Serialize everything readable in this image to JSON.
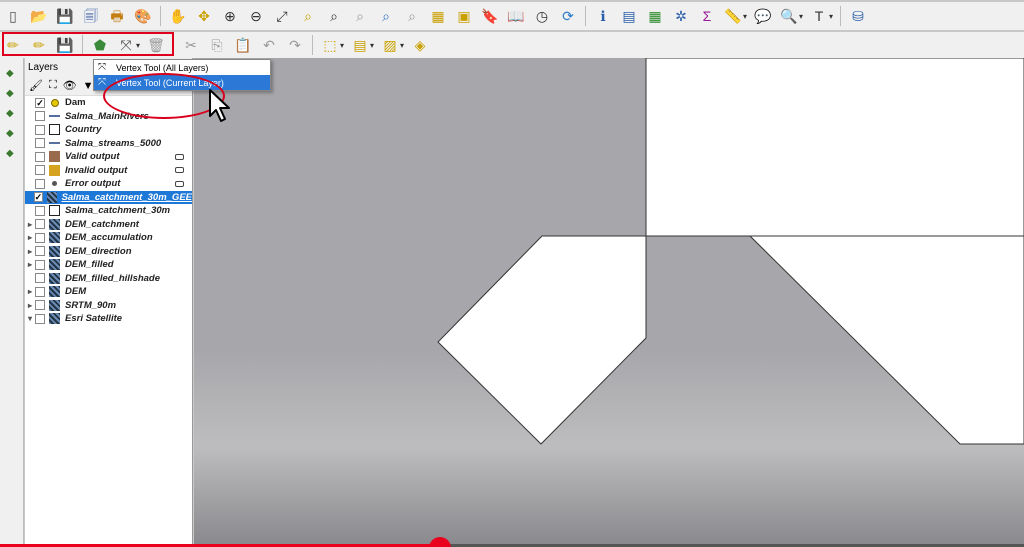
{
  "toolbar1": {
    "icons": [
      "new-project-icon",
      "open-folder-icon",
      "save-icon",
      "save-as-icon",
      "print-layout-icon",
      "style-manager-icon",
      "pan-hand-icon",
      "pan-to-selection-icon",
      "zoom-in-icon",
      "zoom-out-icon",
      "zoom-full-icon",
      "zoom-to-selection-icon",
      "zoom-to-layer-icon",
      "zoom-native-icon",
      "zoom-last-icon",
      "zoom-next-icon",
      "new-map-view-icon",
      "new-3d-view-icon",
      "new-bookmark-icon",
      "show-bookmarks-icon",
      "temporal-icon",
      "refresh-icon",
      "identify-icon",
      "attribute-table-icon",
      "field-calculator-icon",
      "processing-toolbox-icon",
      "statistics-icon",
      "measure-icon",
      "annotation-icon",
      "label-tool-icon",
      "text-annotation-icon",
      "database-icon"
    ]
  },
  "toolbar2": {
    "icons": [
      "toggle-editing-pencil-icon",
      "current-edits-pencil-icon",
      "save-edits-icon",
      "add-polygon-icon",
      "vertex-tool-icon",
      "delete-selected-icon",
      "cut-icon",
      "copy-icon",
      "paste-icon",
      "undo-icon",
      "redo-icon",
      "select-features-icon",
      "select-by-value-icon",
      "deselect-icon",
      "snapping-icon"
    ]
  },
  "layers_panel": {
    "title": "Layers",
    "layers": [
      {
        "name": "Dam",
        "checked": true,
        "symbol": "point-yellow",
        "expander": "",
        "bold_plain": true
      },
      {
        "name": "Salma_MainRivers",
        "checked": false,
        "symbol": "line",
        "expander": ""
      },
      {
        "name": "Country",
        "checked": false,
        "symbol": "box",
        "expander": ""
      },
      {
        "name": "Salma_streams_5000",
        "checked": false,
        "symbol": "line",
        "expander": ""
      },
      {
        "name": "Valid output",
        "checked": false,
        "symbol": "brown",
        "expander": "",
        "pill": true
      },
      {
        "name": "Invalid output",
        "checked": false,
        "symbol": "mustard",
        "expander": "",
        "pill": true
      },
      {
        "name": "Error output",
        "checked": false,
        "symbol": "dot",
        "expander": "",
        "pill": true
      },
      {
        "name": "Salma_catchment_30m_GEE",
        "checked": true,
        "symbol": "raster",
        "expander": "",
        "selected": true
      },
      {
        "name": "Salma_catchment_30m",
        "checked": false,
        "symbol": "box",
        "expander": ""
      },
      {
        "name": "DEM_catchment",
        "checked": false,
        "symbol": "raster",
        "expander": "▸"
      },
      {
        "name": "DEM_accumulation",
        "checked": false,
        "symbol": "raster",
        "expander": "▸"
      },
      {
        "name": "DEM_direction",
        "checked": false,
        "symbol": "raster",
        "expander": "▸"
      },
      {
        "name": "DEM_filled",
        "checked": false,
        "symbol": "raster",
        "expander": "▸"
      },
      {
        "name": "DEM_filled_hillshade",
        "checked": false,
        "symbol": "raster",
        "expander": ""
      },
      {
        "name": "DEM",
        "checked": false,
        "symbol": "raster",
        "expander": "▸"
      },
      {
        "name": "SRTM_90m",
        "checked": false,
        "symbol": "raster",
        "expander": "▸"
      },
      {
        "name": "Esri Satellite",
        "checked": false,
        "symbol": "raster",
        "expander": "▾"
      }
    ]
  },
  "dropdown": {
    "items": [
      {
        "label": "Vertex Tool (All Layers)",
        "highlighted": false
      },
      {
        "label": "Vertex Tool (Current Layer)",
        "highlighted": true
      }
    ]
  },
  "video": {
    "progress_fraction": 0.43
  },
  "colors": {
    "annotation_red": "#e0001b",
    "selection_blue": "#1e78d7",
    "map_gray": "#a7a7ab",
    "polygon_white": "#ffffff"
  }
}
